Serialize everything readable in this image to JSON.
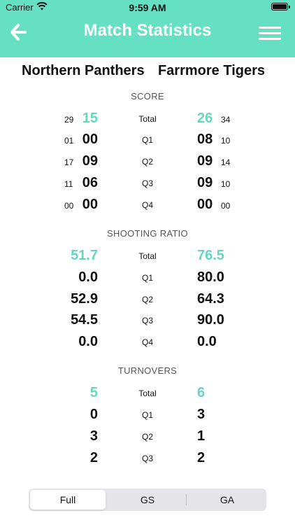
{
  "statusbar": {
    "carrier": "Carrier",
    "time": "9:59 AM"
  },
  "header": {
    "title": "Match Statistics"
  },
  "teams": {
    "home": "Northern Panthers",
    "away": "Farrmore Tigers"
  },
  "sections": {
    "score": {
      "title": "SCORE",
      "rows": [
        {
          "label": "Total",
          "home_small": "29",
          "home": "15",
          "away": "26",
          "away_small": "34"
        },
        {
          "label": "Q1",
          "home_small": "01",
          "home": "00",
          "away": "08",
          "away_small": "10"
        },
        {
          "label": "Q2",
          "home_small": "17",
          "home": "09",
          "away": "09",
          "away_small": "14"
        },
        {
          "label": "Q3",
          "home_small": "11",
          "home": "06",
          "away": "09",
          "away_small": "10"
        },
        {
          "label": "Q4",
          "home_small": "00",
          "home": "00",
          "away": "00",
          "away_small": "00"
        }
      ]
    },
    "shooting": {
      "title": "SHOOTING RATIO",
      "rows": [
        {
          "label": "Total",
          "home": "51.7",
          "away": "76.5"
        },
        {
          "label": "Q1",
          "home": "0.0",
          "away": "80.0"
        },
        {
          "label": "Q2",
          "home": "52.9",
          "away": "64.3"
        },
        {
          "label": "Q3",
          "home": "54.5",
          "away": "90.0"
        },
        {
          "label": "Q4",
          "home": "0.0",
          "away": "0.0"
        }
      ]
    },
    "turnovers": {
      "title": "TURNOVERS",
      "rows": [
        {
          "label": "Total",
          "home": "5",
          "away": "6"
        },
        {
          "label": "Q1",
          "home": "0",
          "away": "3"
        },
        {
          "label": "Q2",
          "home": "3",
          "away": "1"
        },
        {
          "label": "Q3",
          "home": "2",
          "away": "2"
        }
      ]
    }
  },
  "segmented": {
    "options": [
      "Full",
      "GS",
      "GA"
    ],
    "selected": "Full"
  },
  "colors": {
    "header": "#66e0c2",
    "accent": "#66d6bf"
  },
  "icons": {
    "back": "back-arrow-icon",
    "menu": "hamburger-menu-icon",
    "wifi": "wifi-icon",
    "battery": "battery-icon"
  }
}
